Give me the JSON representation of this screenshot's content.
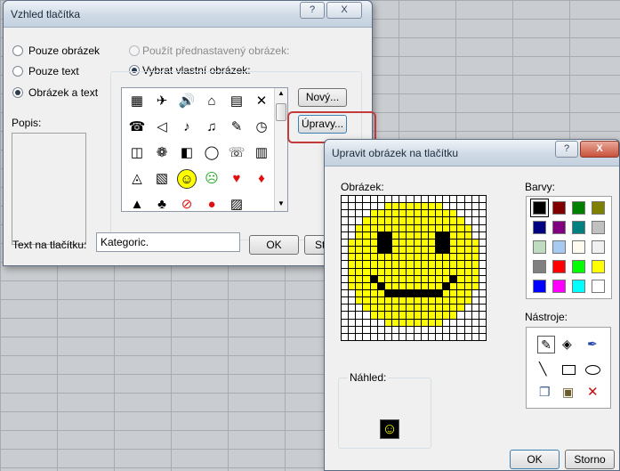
{
  "dialog1": {
    "title": "Vzhled tlačítka",
    "help": "?",
    "close": "X",
    "radio_image": "Pouze obrázek",
    "radio_text": "Pouze text",
    "radio_image_text": "Obrázek a text",
    "radio_preset": "Použít přednastavený obrázek:",
    "radio_custom": "Vybrat vlastní obrázek:",
    "desc_label": "Popis:",
    "new_button": "Nový...",
    "edit_button": "Úpravy...",
    "text_label": "Text na tlačítku:",
    "text_value": "Kategoric.",
    "ok": "OK",
    "cancel_partial": "St"
  },
  "icons": [
    {
      "glyph": "▦",
      "name": "calculator-icon"
    },
    {
      "glyph": "✈",
      "name": "figure-icon"
    },
    {
      "glyph": "🔊",
      "name": "sound-icon"
    },
    {
      "glyph": "⌂",
      "name": "house-icon"
    },
    {
      "glyph": "▤",
      "name": "building-icon"
    },
    {
      "glyph": "✕",
      "name": "cross-icon"
    },
    {
      "glyph": "☎",
      "name": "telephone-icon"
    },
    {
      "glyph": "◁",
      "name": "speaker-icon"
    },
    {
      "glyph": "♪",
      "name": "music-note-icon"
    },
    {
      "glyph": "♫",
      "name": "music-notes-icon"
    },
    {
      "glyph": "✎",
      "name": "pen-icon"
    },
    {
      "glyph": "◷",
      "name": "clock-icon"
    },
    {
      "glyph": "◫",
      "name": "book-icon"
    },
    {
      "glyph": "❁",
      "name": "flower-icon"
    },
    {
      "glyph": "◧",
      "name": "camera-icon"
    },
    {
      "glyph": "◯",
      "name": "speech-bubble-icon"
    },
    {
      "glyph": "☏",
      "name": "phone-icon"
    },
    {
      "glyph": "▥",
      "name": "trash-icon"
    },
    {
      "glyph": "◬",
      "name": "bell-icon"
    },
    {
      "glyph": "▧",
      "name": "dice-icon"
    },
    {
      "glyph": "☺",
      "name": "smiley-icon",
      "color": "#ffff00"
    },
    {
      "glyph": "☹",
      "name": "sad-face-icon",
      "color": "#22aa22"
    },
    {
      "glyph": "♥",
      "name": "heart-icon",
      "color": "#e01010"
    },
    {
      "glyph": "♦",
      "name": "diamond-icon",
      "color": "#e01010"
    },
    {
      "glyph": "▲",
      "name": "triangle-icon"
    },
    {
      "glyph": "♣",
      "name": "club-icon"
    },
    {
      "glyph": "⊘",
      "name": "no-sign-icon",
      "color": "#e01010"
    },
    {
      "glyph": "●",
      "name": "stop-sign-icon",
      "color": "#e01010"
    },
    {
      "glyph": "▨",
      "name": "hatch-icon"
    }
  ],
  "dialog2": {
    "title": "Upravit obrázek na tlačítku",
    "help": "?",
    "close": "X",
    "image_label": "Obrázek:",
    "colors_label": "Barvy:",
    "tools_label": "Nástroje:",
    "preview_label": "Náhled:",
    "ok": "OK",
    "cancel": "Storno"
  },
  "palette": [
    "#000000",
    "#800000",
    "#008000",
    "#808000",
    "#000080",
    "#800080",
    "#008080",
    "#c0c0c0",
    "#c0dcc0",
    "#a6caf0",
    "#fffbf0",
    "#f0f0f0",
    "#808080",
    "#ff0000",
    "#00ff00",
    "#ffff00",
    "#0000ff",
    "#ff00ff",
    "#00ffff",
    "#ffffff"
  ],
  "bitmap": [
    "....................",
    "......YYYYYYYY......",
    "....YYYYYYYYYYYY....",
    "...YYYYYYYYYYYYYY...",
    "..YYYYYYYYYYYYYYYY..",
    "..YYYKKYYYYYYKKYYY..",
    ".YYYYKKYYYYYYKKYYYY.",
    ".YYYYKKYYYYYYKKYYYY.",
    ".YYYYYYYYYYYYYYYYYY.",
    ".YYYYYYYYYYYYYYYYYY.",
    ".YYYYYYYYYYYYYYYYYY.",
    ".YYYKYYYYYYYYYYKYYY.",
    ".YYYYKYYYYYYYYKYYYY.",
    "..YYYYKKKKKKKKYYYY..",
    "..YYYYYYYYYYYYYYYY..",
    "...YYYYYYYYYYYYYY...",
    "....YYYYYYYYYYYY....",
    "......YYYYYYYY......",
    "....................",
    "...................."
  ]
}
